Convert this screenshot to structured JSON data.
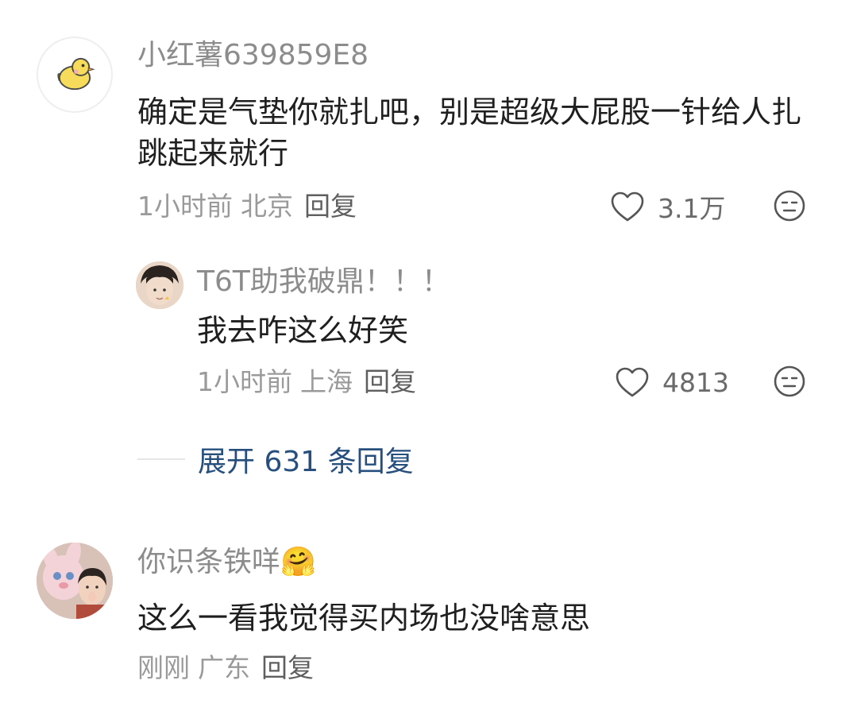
{
  "comments": [
    {
      "username": "小红薯639859E8",
      "text": "确定是气垫你就扎吧，别是超级大屁股一针给人扎跳起来就行",
      "time": "1小时前",
      "location": "北京",
      "reply_label": "回复",
      "likes": "3.1万",
      "avatar_icon": "yellow-chick-icon",
      "replies": [
        {
          "username": "T6T助我破鼎！！！",
          "text": "我去咋这么好笑",
          "time": "1小时前",
          "location": "上海",
          "reply_label": "回复",
          "likes": "4813",
          "avatar_icon": "person-photo-avatar"
        }
      ],
      "expand_label": "展开 631 条回复"
    },
    {
      "username": "你识条铁咩",
      "username_emoji": "🤗",
      "text": "这么一看我觉得买内场也没啥意思",
      "time": "刚刚",
      "location": "广东",
      "reply_label": "回复",
      "avatar_icon": "plush-toy-selfie-avatar"
    }
  ],
  "colors": {
    "username": "#8c8c8c",
    "text": "#1f1f1f",
    "meta": "#9a9a9a",
    "expand_link": "#274f7d"
  }
}
